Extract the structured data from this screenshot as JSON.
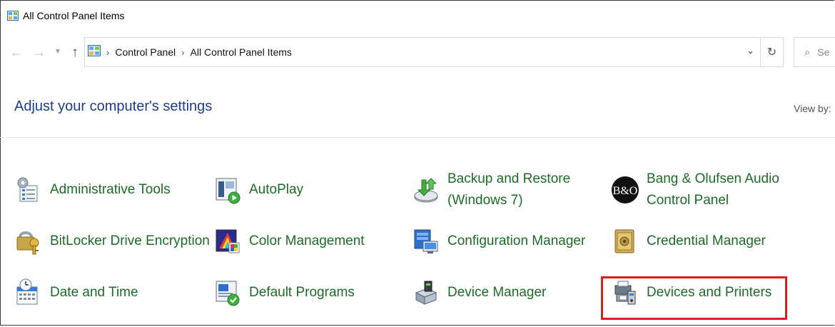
{
  "window": {
    "title": "All Control Panel Items"
  },
  "nav": {
    "back_icon": "arrow-left-icon",
    "forward_icon": "arrow-right-icon",
    "recent_icon": "chevron-down-icon",
    "up_icon": "arrow-up-icon"
  },
  "address": {
    "crumbs": [
      "Control Panel",
      "All Control Panel Items"
    ],
    "separator": "›"
  },
  "search": {
    "placeholder": "Se"
  },
  "header": {
    "heading": "Adjust your computer's settings",
    "view_by_label": "View by:"
  },
  "items": [
    {
      "label_lines": [
        "Administrative Tools"
      ],
      "icon": "admin-tools-icon"
    },
    {
      "label_lines": [
        "AutoPlay"
      ],
      "icon": "autoplay-icon"
    },
    {
      "label_lines": [
        "Backup and Restore",
        "(Windows 7)"
      ],
      "icon": "backup-restore-icon"
    },
    {
      "label_lines": [
        "Bang & Olufsen Audio",
        "Control Panel"
      ],
      "icon": "bang-olufsen-icon",
      "logo_text": "B&O"
    },
    {
      "label_lines": [
        "BitLocker Drive Encryption"
      ],
      "icon": "bitlocker-key-icon"
    },
    {
      "label_lines": [
        "Color Management"
      ],
      "icon": "color-management-icon"
    },
    {
      "label_lines": [
        "Configuration Manager"
      ],
      "icon": "configuration-manager-icon"
    },
    {
      "label_lines": [
        "Credential Manager"
      ],
      "icon": "credential-manager-icon"
    },
    {
      "label_lines": [
        "Date and Time"
      ],
      "icon": "date-time-icon"
    },
    {
      "label_lines": [
        "Default Programs"
      ],
      "icon": "default-programs-icon"
    },
    {
      "label_lines": [
        "Device Manager"
      ],
      "icon": "device-manager-icon"
    },
    {
      "label_lines": [
        "Devices and Printers"
      ],
      "icon": "devices-printers-icon"
    }
  ],
  "colors": {
    "link_green": "#1e6b28",
    "heading_blue": "#1e3d8c",
    "highlight_red": "#e21b1b"
  }
}
